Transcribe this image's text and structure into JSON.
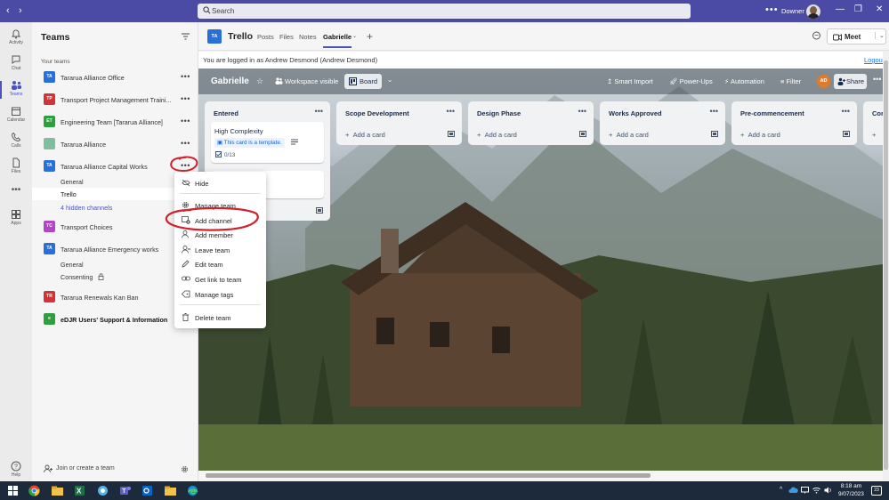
{
  "titlebar": {
    "search_placeholder": "Search",
    "user_name": "Downer",
    "more": "•••"
  },
  "rail": {
    "items": [
      {
        "label": "Activity",
        "icon": "bell-icon"
      },
      {
        "label": "Chat",
        "icon": "chat-icon"
      },
      {
        "label": "Teams",
        "icon": "teams-icon",
        "active": true
      },
      {
        "label": "Calendar",
        "icon": "calendar-icon"
      },
      {
        "label": "Calls",
        "icon": "phone-icon"
      },
      {
        "label": "Files",
        "icon": "file-icon"
      },
      {
        "label": "•••",
        "icon": "more-icon"
      },
      {
        "label": "Apps",
        "icon": "apps-icon"
      },
      {
        "label": "Help",
        "icon": "help-icon"
      }
    ]
  },
  "sidebar": {
    "title": "Teams",
    "section": "Your teams",
    "teams": [
      {
        "initials": "TA",
        "name": "Tararua Alliance Office",
        "color": "#2a6fd6"
      },
      {
        "initials": "TP",
        "name": "Transport Project Management Traini...",
        "color": "#d13438"
      },
      {
        "initials": "ET",
        "name": "Engineering Team [Tararua Alliance]",
        "color": "#2e9e3e"
      },
      {
        "initials": "",
        "name": "Tararua Alliance",
        "color": "#7fbf9f"
      },
      {
        "initials": "TA",
        "name": "Tararua Alliance Capital Works",
        "color": "#2a6fd6"
      },
      {
        "initials": "TC",
        "name": "Transport Choices",
        "color": "#b146c2"
      },
      {
        "initials": "TA",
        "name": "Tararua Alliance Emergency works",
        "color": "#2a6fd6"
      },
      {
        "initials": "TR",
        "name": "Tararua Renewals Kan Ban",
        "color": "#d13438"
      },
      {
        "initials": "e",
        "name": "eDJR Users' Support & Information",
        "color": "#2e9e3e"
      }
    ],
    "capital_works_channels": [
      "General",
      "Trello",
      "4 hidden channels"
    ],
    "emergency_channels": [
      "General",
      "Consenting"
    ],
    "footer": "Join or create a team"
  },
  "channel_header": {
    "initials": "TA",
    "name": "Trello",
    "tabs": [
      "Posts",
      "Files",
      "Notes",
      "Gabrielle"
    ],
    "meet_label": "Meet"
  },
  "login_bar": {
    "text": "You are logged in as Andrew Desmond (Andrew Desmond)",
    "logout": "Logout"
  },
  "board": {
    "name": "Gabrielle",
    "visibility": "Workspace visible",
    "view": "Board",
    "smart_import": "Smart Import",
    "power_ups": "Power-Ups",
    "automation": "Automation",
    "filter": "Filter",
    "avatar": "AD",
    "share": "Share",
    "lists": [
      {
        "name": "Entered"
      },
      {
        "name": "Scope Development",
        "add": "Add a card"
      },
      {
        "name": "Design Phase",
        "add": "Add a card"
      },
      {
        "name": "Works Approved",
        "add": "Add a card"
      },
      {
        "name": "Pre-commencement",
        "add": "Add a card"
      },
      {
        "name": "Cor"
      }
    ],
    "card": {
      "title": "High Complexity",
      "template_badge": "This card is a template.",
      "checklist": "0/13"
    }
  },
  "context_menu": {
    "items": [
      {
        "label": "Hide",
        "icon": "hide-icon"
      },
      {
        "label": "Manage team",
        "icon": "gear-icon"
      },
      {
        "label": "Add channel",
        "icon": "add-channel-icon"
      },
      {
        "label": "Add member",
        "icon": "add-member-icon"
      },
      {
        "label": "Leave team",
        "icon": "leave-icon"
      },
      {
        "label": "Edit team",
        "icon": "edit-icon"
      },
      {
        "label": "Get link to team",
        "icon": "link-icon"
      },
      {
        "label": "Manage tags",
        "icon": "tag-icon"
      },
      {
        "label": "Delete team",
        "icon": "trash-icon"
      }
    ]
  },
  "taskbar": {
    "time": "8:18 am",
    "date": "9/07/2023",
    "notifications": "23"
  }
}
